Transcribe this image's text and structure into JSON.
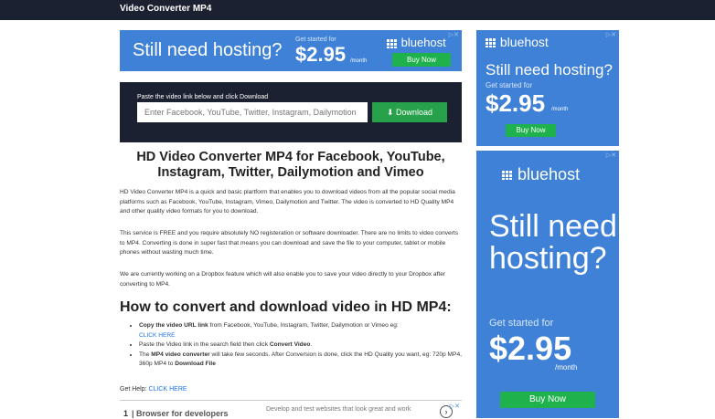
{
  "header": {
    "brand": "Video Converter MP4"
  },
  "ads": {
    "adchoices": "▷✕",
    "top": {
      "headline": "Still need hosting?",
      "get_started": "Get started for",
      "price": "$2.95",
      "per": "/month",
      "logo": "bluehost",
      "buy": "Buy Now"
    },
    "side1": {
      "logo": "bluehost",
      "headline": "Still need hosting?",
      "get_started": "Get started for",
      "price": "$2.95",
      "per": "/month",
      "buy": "Buy Now"
    },
    "side2": {
      "logo": "bluehost",
      "headline": "Still need hosting?",
      "get_started": "Get started for",
      "price": "$2.95",
      "per": "/month",
      "buy": "Buy Now"
    },
    "bottom": {
      "number": "1",
      "title": "Browser for developers",
      "desc": "Develop and test websites that look great and work"
    }
  },
  "search": {
    "label": "Paste the video link below and click Download",
    "placeholder": "Enter Facebook, YouTube, Twitter, Instagram, Dailymotion",
    "download_label": "Download"
  },
  "content": {
    "title": "HD Video Converter MP4 for Facebook, YouTube, Instagram, Twitter, Dailymotion and Vimeo",
    "p1": "HD Video Converter MP4 is a quick and basic plartform that enables you to download videos from all the popular social media platforms such as Facebook, YouTube, Instagram, Vimeo, Dailymotion and Twitter. The video is converted to HD Quality MP4 and other quality video formats for you to download.",
    "p2": "This service is FREE and you require absolutely NO registeration or software downloader. There are no limits to video converts to MP4. Converting is done in super fast that means you can download and save the file to your computer, tablet or mobile phones without wasting much time.",
    "p3": "We are currently working on a Dropbox feature which will also enable you to save your video directly to your Dropbox after converting to MP4.",
    "howto_title": "How to convert and download video in HD MP4:",
    "steps": {
      "s1_bold": "Copy the video URL link",
      "s1_text": " from Facebook, YouTube, Instagram, Twitter, Dailymotion or Vimeo eg:",
      "s1_link": "CLICK HERE",
      "s2_text": "Paste the Video link in the search field then click ",
      "s2_bold": "Convert Video",
      "s2_end": ".",
      "s3_pre": "The ",
      "s3_bold": "MP4 video converter",
      "s3_text": " will take few seconds. After Conversion is done, click the HD Quality you want, eg: 720p MP4, 360p MP4 to ",
      "s3_bold2": "Download File"
    },
    "help_label": "Get Help:",
    "help_link": "CLICK HERE"
  }
}
